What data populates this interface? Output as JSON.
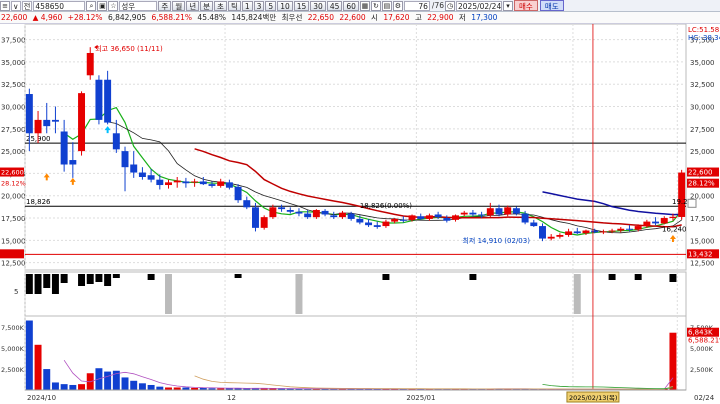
{
  "toolbar": {
    "menu_icon": "menu-icon",
    "mode_label": "∨",
    "type_label": "전",
    "code": "458650",
    "search_icon": "search-icon",
    "lock_icon": "lock-icon",
    "name": "성우",
    "period_buttons": [
      "주",
      "월",
      "년",
      "분",
      "초",
      "틱"
    ],
    "interval_buttons": [
      "1",
      "3",
      "5",
      "10",
      "15",
      "30",
      "45",
      "60"
    ],
    "count": "76",
    "count_total": "/76",
    "date": "2025/02/24",
    "buy_label": "매수",
    "sell_label": "매도"
  },
  "infobar": {
    "price": "22,600",
    "change": "▲ 4,960",
    "change_pct": "+28.12%",
    "volume": "6,842,905",
    "volume_ratio": "6,588.21%",
    "turnover": "45.48%",
    "amount": "145,824백만",
    "best_ask_label": "최우선",
    "best_ask": "22,650",
    "best_bid": "22,600",
    "open_label": "시",
    "open": "17,620",
    "high_label": "고",
    "high": "22,900",
    "low_label": "저",
    "low": "17,300"
  },
  "chart_data": {
    "type": "candlestick",
    "price_axis": {
      "ticks": [
        "37,500",
        "35,000",
        "32,500",
        "30,000",
        "27,500",
        "25,000",
        "22,500",
        "20,000",
        "17,500",
        "15,000",
        "12,500"
      ],
      "range": [
        11900,
        38800
      ]
    },
    "price_axis_right_labels": {
      "lc": "LC:51.58",
      "hc": "HC:-38.34"
    },
    "x_axis": {
      "ticks": [
        "2024/10",
        "12",
        "2025/01",
        "02",
        "02/24"
      ],
      "cursor_label": "2025/02/13(목)"
    },
    "horizontal_lines": [
      {
        "value": 25900,
        "label": "25,900",
        "color": "#000000"
      },
      {
        "value": 18826,
        "label": "18,826",
        "color": "#000000"
      },
      {
        "value": 13432,
        "label": "13,432",
        "color": "#e00000"
      }
    ],
    "right_badges": [
      {
        "value": 22600,
        "text": "22,600",
        "color": "#e00000"
      },
      {
        "value": 21350,
        "text": "28.12%",
        "color": "#e00000"
      },
      {
        "value": 13432,
        "text": "13,432",
        "color": "#e00000"
      }
    ],
    "annotations": {
      "high": "최고 36,650 (11/11)",
      "low": "최저 14,910 (02/03)",
      "mid": "18,826(0.00%)",
      "ma_label": "19.2",
      "ma_label2": "16,240"
    },
    "candles": [
      {
        "o": 31400,
        "h": 32000,
        "l": 25000,
        "c": 27000
      },
      {
        "o": 27000,
        "h": 29500,
        "l": 25900,
        "c": 28500
      },
      {
        "o": 28500,
        "h": 30400,
        "l": 27000,
        "c": 27800
      },
      {
        "o": 28500,
        "h": 30000,
        "l": 27000,
        "c": 28300
      },
      {
        "o": 27200,
        "h": 28500,
        "l": 22700,
        "c": 23500
      },
      {
        "o": 24000,
        "h": 26000,
        "l": 22000,
        "c": 23500
      },
      {
        "o": 25000,
        "h": 31700,
        "l": 24500,
        "c": 31500
      },
      {
        "o": 33500,
        "h": 36650,
        "l": 33000,
        "c": 36000
      },
      {
        "o": 33000,
        "h": 33500,
        "l": 28000,
        "c": 28500
      },
      {
        "o": 33000,
        "h": 34000,
        "l": 28000,
        "c": 28200
      },
      {
        "o": 27000,
        "h": 28500,
        "l": 24800,
        "c": 25200
      },
      {
        "o": 25000,
        "h": 25500,
        "l": 20500,
        "c": 23200
      },
      {
        "o": 23500,
        "h": 25000,
        "l": 22000,
        "c": 22600
      },
      {
        "o": 22600,
        "h": 23200,
        "l": 21800,
        "c": 22100
      },
      {
        "o": 22300,
        "h": 23000,
        "l": 21500,
        "c": 21800
      },
      {
        "o": 21800,
        "h": 22400,
        "l": 20700,
        "c": 21200
      },
      {
        "o": 21200,
        "h": 21800,
        "l": 20800,
        "c": 21500
      },
      {
        "o": 21500,
        "h": 22100,
        "l": 20900,
        "c": 21700
      },
      {
        "o": 21600,
        "h": 22000,
        "l": 20900,
        "c": 21400
      },
      {
        "o": 21500,
        "h": 21900,
        "l": 21000,
        "c": 21600
      },
      {
        "o": 21600,
        "h": 22100,
        "l": 21200,
        "c": 21300
      },
      {
        "o": 21300,
        "h": 21600,
        "l": 20900,
        "c": 21100
      },
      {
        "o": 21100,
        "h": 21900,
        "l": 20900,
        "c": 21600
      },
      {
        "o": 21500,
        "h": 21800,
        "l": 20700,
        "c": 20900
      },
      {
        "o": 21000,
        "h": 21300,
        "l": 19200,
        "c": 19500
      },
      {
        "o": 19500,
        "h": 19900,
        "l": 18500,
        "c": 18700
      },
      {
        "o": 18700,
        "h": 19200,
        "l": 16000,
        "c": 16400
      },
      {
        "o": 16400,
        "h": 17800,
        "l": 16200,
        "c": 17600
      },
      {
        "o": 17600,
        "h": 19000,
        "l": 17400,
        "c": 18700
      },
      {
        "o": 18700,
        "h": 19000,
        "l": 18200,
        "c": 18500
      },
      {
        "o": 18400,
        "h": 18700,
        "l": 18000,
        "c": 18200
      },
      {
        "o": 18200,
        "h": 18600,
        "l": 17700,
        "c": 18000
      },
      {
        "o": 18000,
        "h": 18400,
        "l": 17400,
        "c": 17600
      },
      {
        "o": 17600,
        "h": 18500,
        "l": 17400,
        "c": 18400
      },
      {
        "o": 18300,
        "h": 18500,
        "l": 17700,
        "c": 17900
      },
      {
        "o": 17800,
        "h": 18200,
        "l": 17400,
        "c": 17600
      },
      {
        "o": 17600,
        "h": 18300,
        "l": 17400,
        "c": 18100
      },
      {
        "o": 18000,
        "h": 18200,
        "l": 17200,
        "c": 17400
      },
      {
        "o": 17400,
        "h": 17800,
        "l": 16800,
        "c": 17000
      },
      {
        "o": 17000,
        "h": 17400,
        "l": 16500,
        "c": 16700
      },
      {
        "o": 16700,
        "h": 17100,
        "l": 16300,
        "c": 16500
      },
      {
        "o": 16600,
        "h": 17300,
        "l": 16400,
        "c": 17100
      },
      {
        "o": 17100,
        "h": 17500,
        "l": 16900,
        "c": 17400
      },
      {
        "o": 17300,
        "h": 17700,
        "l": 17000,
        "c": 17200
      },
      {
        "o": 17300,
        "h": 17900,
        "l": 17100,
        "c": 17800
      },
      {
        "o": 17700,
        "h": 18000,
        "l": 17300,
        "c": 17400
      },
      {
        "o": 17400,
        "h": 18000,
        "l": 17200,
        "c": 17800
      },
      {
        "o": 17900,
        "h": 18200,
        "l": 17400,
        "c": 17600
      },
      {
        "o": 17500,
        "h": 17800,
        "l": 17000,
        "c": 17200
      },
      {
        "o": 17300,
        "h": 17900,
        "l": 17100,
        "c": 17800
      },
      {
        "o": 17900,
        "h": 18300,
        "l": 17700,
        "c": 18100
      },
      {
        "o": 18100,
        "h": 18400,
        "l": 17700,
        "c": 17900
      },
      {
        "o": 17900,
        "h": 18200,
        "l": 17500,
        "c": 17800
      },
      {
        "o": 17800,
        "h": 19200,
        "l": 17600,
        "c": 18600
      },
      {
        "o": 18600,
        "h": 19000,
        "l": 17700,
        "c": 17900
      },
      {
        "o": 17900,
        "h": 18900,
        "l": 17700,
        "c": 18700
      },
      {
        "o": 18600,
        "h": 18800,
        "l": 17800,
        "c": 18000
      },
      {
        "o": 18000,
        "h": 18300,
        "l": 16800,
        "c": 17000
      },
      {
        "o": 17000,
        "h": 17300,
        "l": 16500,
        "c": 16600
      },
      {
        "o": 16600,
        "h": 16900,
        "l": 14910,
        "c": 15200
      },
      {
        "o": 15200,
        "h": 15700,
        "l": 15000,
        "c": 15400
      },
      {
        "o": 15400,
        "h": 15800,
        "l": 15200,
        "c": 15600
      },
      {
        "o": 15600,
        "h": 16300,
        "l": 15400,
        "c": 16000
      },
      {
        "o": 16000,
        "h": 16400,
        "l": 15700,
        "c": 15800
      },
      {
        "o": 15800,
        "h": 16200,
        "l": 15600,
        "c": 16100
      },
      {
        "o": 16100,
        "h": 16300,
        "l": 15800,
        "c": 15900
      },
      {
        "o": 15900,
        "h": 16200,
        "l": 15700,
        "c": 16000
      },
      {
        "o": 16000,
        "h": 16300,
        "l": 15800,
        "c": 16100
      },
      {
        "o": 16100,
        "h": 16500,
        "l": 15900,
        "c": 16300
      },
      {
        "o": 16300,
        "h": 16700,
        "l": 16000,
        "c": 16200
      },
      {
        "o": 16200,
        "h": 16800,
        "l": 16000,
        "c": 16600
      },
      {
        "o": 16600,
        "h": 17300,
        "l": 16400,
        "c": 17100
      },
      {
        "o": 17100,
        "h": 17600,
        "l": 16700,
        "c": 16900
      },
      {
        "o": 16900,
        "h": 17700,
        "l": 16800,
        "c": 17500
      },
      {
        "o": 17500,
        "h": 18000,
        "l": 17200,
        "c": 17640
      },
      {
        "o": 17620,
        "h": 22900,
        "l": 17300,
        "c": 22600
      }
    ],
    "indicator": {
      "label": "5",
      "bars": [
        1,
        1,
        0.7,
        1,
        0.45,
        0,
        0.6,
        0.5,
        0.4,
        0.6,
        0.2,
        0,
        0,
        0,
        0.3,
        0,
        0,
        0,
        0,
        0,
        0,
        0,
        0,
        0,
        0.2,
        0,
        0,
        0,
        0,
        0,
        0,
        0.3,
        0,
        0,
        0,
        0,
        0,
        0,
        0,
        0,
        0,
        0.3,
        0,
        0,
        0,
        0,
        0,
        0,
        0,
        0,
        0,
        0.3,
        0,
        0,
        0,
        0,
        0,
        0,
        0,
        0,
        0,
        0,
        0,
        0,
        0,
        0,
        0,
        0.3,
        0,
        0,
        0.3,
        0,
        0,
        0,
        0.4,
        0
      ],
      "gray_bars": [
        16,
        31,
        63
      ]
    },
    "volume": {
      "ticks": [
        "7,500K",
        "5,000K",
        "2,500K"
      ],
      "range": [
        0,
        8600000
      ],
      "right_labels": [
        "6,843K",
        "6,588.21%"
      ],
      "values": [
        8300000,
        5400000,
        2500000,
        900000,
        700000,
        600000,
        700000,
        2000000,
        2600000,
        2200000,
        2300000,
        1500000,
        1100000,
        800000,
        600000,
        400000,
        300000,
        300000,
        300000,
        250000,
        250000,
        200000,
        200000,
        200000,
        200000,
        180000,
        220000,
        200000,
        180000,
        160000,
        160000,
        150000,
        150000,
        150000,
        140000,
        150000,
        150000,
        150000,
        140000,
        140000,
        130000,
        140000,
        140000,
        130000,
        130000,
        130000,
        120000,
        130000,
        130000,
        130000,
        120000,
        120000,
        130000,
        180000,
        140000,
        130000,
        130000,
        120000,
        110000,
        110000,
        100000,
        100000,
        100000,
        100000,
        100000,
        90000,
        90000,
        90000,
        90000,
        90000,
        100000,
        100000,
        120000,
        130000,
        6842905
      ]
    }
  }
}
